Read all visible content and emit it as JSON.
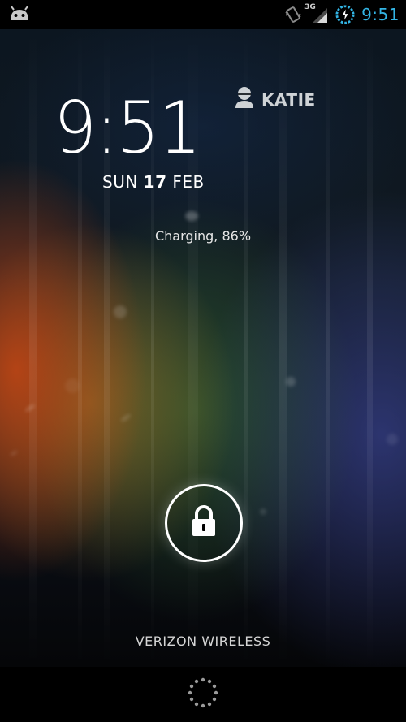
{
  "status_bar": {
    "time": "9:51",
    "network_label": "3G",
    "icons": [
      "android-notification-icon",
      "vibrate-icon",
      "signal-3g-icon",
      "battery-charging-icon"
    ],
    "accent_color": "#33b5e5"
  },
  "lockscreen": {
    "clock": "9:51",
    "date_day": "SUN",
    "date_num": "17",
    "date_month": "FEB",
    "owner_name": "KATIE",
    "charging_status": "Charging, 86%",
    "unlock_icon": "lock-icon",
    "carrier": "VERIZON WIRELESS"
  },
  "nav_bar": {
    "icon": "loading-spinner-icon"
  }
}
